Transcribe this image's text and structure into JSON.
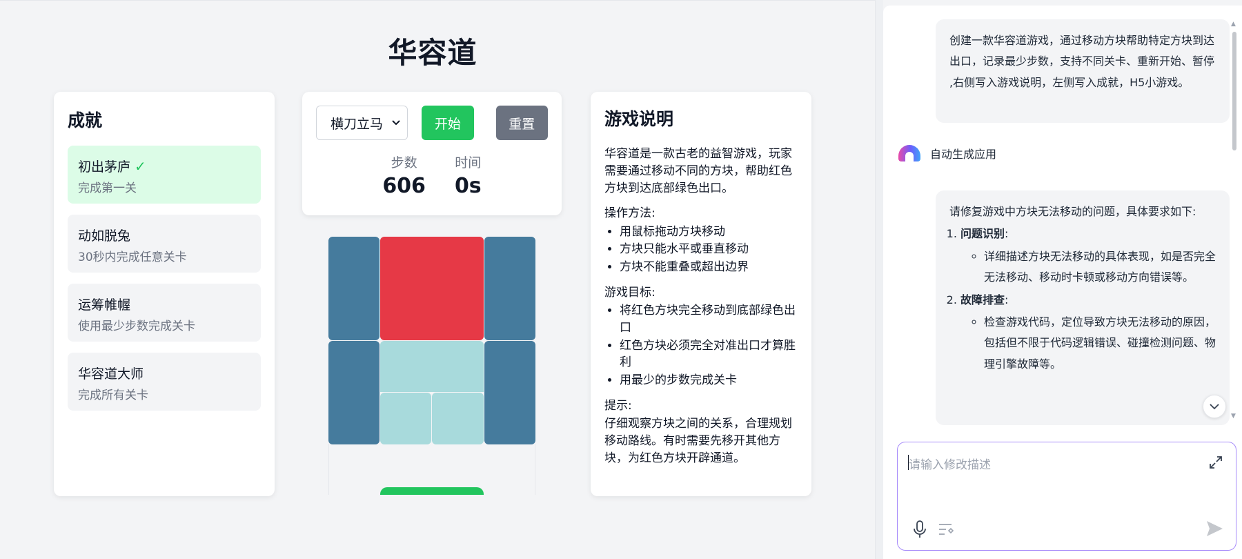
{
  "game": {
    "title": "华容道",
    "achievements_title": "成就",
    "achievements": [
      {
        "name": "初出茅庐",
        "desc": "完成第一关",
        "unlocked": true,
        "check": "✓"
      },
      {
        "name": "动如脱兔",
        "desc": "30秒内完成任意关卡",
        "unlocked": false
      },
      {
        "name": "运筹帷幄",
        "desc": "使用最少步数完成关卡",
        "unlocked": false
      },
      {
        "name": "华容道大师",
        "desc": "完成所有关卡",
        "unlocked": false
      }
    ],
    "level_selected": "横刀立马",
    "start_label": "开始",
    "reset_label": "重置",
    "steps_label": "步数",
    "steps_value": "606",
    "time_label": "时间",
    "time_value": "0s",
    "instructions": {
      "title": "游戏说明",
      "intro": "华容道是一款古老的益智游戏，玩家需要通过移动不同的方块，帮助红色方块到达底部绿色出口。",
      "ops_title": "操作方法:",
      "ops": [
        "用鼠标拖动方块移动",
        "方块只能水平或垂直移动",
        "方块不能重叠或超出边界"
      ],
      "goal_title": "游戏目标:",
      "goals": [
        "将红色方块完全移动到底部绿色出口",
        "红色方块必须完全对准出口才算胜利",
        "用最少的步数完成关卡"
      ],
      "tip_title": "提示:",
      "tip": "仔细观察方块之间的关系，合理规划移动路线。有时需要先移开其他方块，为红色方块开辟通道。"
    },
    "colors": {
      "target": "#e63946",
      "tall": "#457b9d",
      "small": "#a8dadc",
      "exit": "#22c55e"
    }
  },
  "chat": {
    "user_msg_1": "创建一款华容道游戏，通过移动方块帮助特定方块到达出口，记录最少步数，支持不同关卡、重新开始、暂停 ,右侧写入游戏说明，左侧写入成就，H5小游戏。",
    "bot_label": "自动生成应用",
    "user_msg_2": {
      "intro": "请修复游戏中方块无法移动的问题，具体要求如下:",
      "items": [
        {
          "title": "问题识别",
          "detail": "详细描述方块无法移动的具体表现，如是否完全无法移动、移动时卡顿或移动方向错误等。"
        },
        {
          "title": "故障排查",
          "detail": "检查游戏代码，定位导致方块无法移动的原因，包括但不限于代码逻辑错误、碰撞检测问题、物理引擎故障等。"
        }
      ]
    },
    "input_placeholder": "请输入修改描述"
  }
}
